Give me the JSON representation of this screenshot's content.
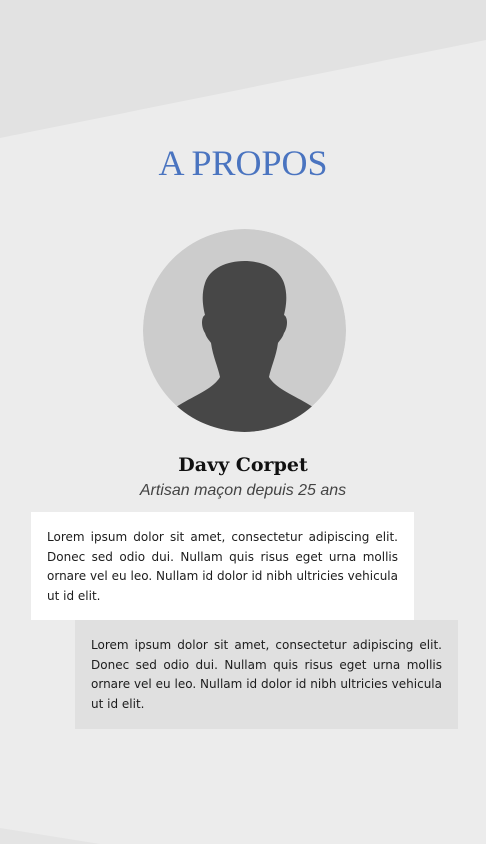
{
  "section": {
    "title": "A PROPOS"
  },
  "profile": {
    "name": "Davy Corpet",
    "role": "Artisan maçon depuis 25 ans",
    "avatar_icon": "user-silhouette-icon"
  },
  "cards": [
    {
      "text": "Lorem ipsum dolor sit amet, consectetur adipiscing elit. Donec sed odio dui. Nullam quis risus eget urna mollis ornare vel eu leo. Nullam id dolor id nibh ultricies vehicula ut id elit."
    },
    {
      "text": "Lorem ipsum dolor sit amet, consectetur adipiscing elit. Donec sed odio dui. Nullam quis risus eget urna mollis ornare vel eu leo. Nullam id dolor id nibh ultricies vehicula ut id elit."
    }
  ],
  "colors": {
    "accent": "#4a74c0",
    "background": "#ececec",
    "background_band": "#e2e2e2",
    "avatar_circle": "#cccccc",
    "avatar_silhouette": "#474747"
  }
}
